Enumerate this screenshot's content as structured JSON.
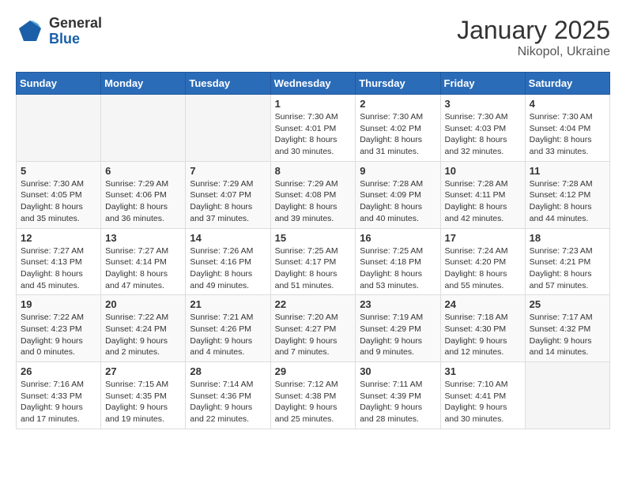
{
  "header": {
    "logo_general": "General",
    "logo_blue": "Blue",
    "title": "January 2025",
    "subtitle": "Nikopol, Ukraine"
  },
  "weekdays": [
    "Sunday",
    "Monday",
    "Tuesday",
    "Wednesday",
    "Thursday",
    "Friday",
    "Saturday"
  ],
  "weeks": [
    [
      {
        "day": "",
        "info": ""
      },
      {
        "day": "",
        "info": ""
      },
      {
        "day": "",
        "info": ""
      },
      {
        "day": "1",
        "info": "Sunrise: 7:30 AM\nSunset: 4:01 PM\nDaylight: 8 hours\nand 30 minutes."
      },
      {
        "day": "2",
        "info": "Sunrise: 7:30 AM\nSunset: 4:02 PM\nDaylight: 8 hours\nand 31 minutes."
      },
      {
        "day": "3",
        "info": "Sunrise: 7:30 AM\nSunset: 4:03 PM\nDaylight: 8 hours\nand 32 minutes."
      },
      {
        "day": "4",
        "info": "Sunrise: 7:30 AM\nSunset: 4:04 PM\nDaylight: 8 hours\nand 33 minutes."
      }
    ],
    [
      {
        "day": "5",
        "info": "Sunrise: 7:30 AM\nSunset: 4:05 PM\nDaylight: 8 hours\nand 35 minutes."
      },
      {
        "day": "6",
        "info": "Sunrise: 7:29 AM\nSunset: 4:06 PM\nDaylight: 8 hours\nand 36 minutes."
      },
      {
        "day": "7",
        "info": "Sunrise: 7:29 AM\nSunset: 4:07 PM\nDaylight: 8 hours\nand 37 minutes."
      },
      {
        "day": "8",
        "info": "Sunrise: 7:29 AM\nSunset: 4:08 PM\nDaylight: 8 hours\nand 39 minutes."
      },
      {
        "day": "9",
        "info": "Sunrise: 7:28 AM\nSunset: 4:09 PM\nDaylight: 8 hours\nand 40 minutes."
      },
      {
        "day": "10",
        "info": "Sunrise: 7:28 AM\nSunset: 4:11 PM\nDaylight: 8 hours\nand 42 minutes."
      },
      {
        "day": "11",
        "info": "Sunrise: 7:28 AM\nSunset: 4:12 PM\nDaylight: 8 hours\nand 44 minutes."
      }
    ],
    [
      {
        "day": "12",
        "info": "Sunrise: 7:27 AM\nSunset: 4:13 PM\nDaylight: 8 hours\nand 45 minutes."
      },
      {
        "day": "13",
        "info": "Sunrise: 7:27 AM\nSunset: 4:14 PM\nDaylight: 8 hours\nand 47 minutes."
      },
      {
        "day": "14",
        "info": "Sunrise: 7:26 AM\nSunset: 4:16 PM\nDaylight: 8 hours\nand 49 minutes."
      },
      {
        "day": "15",
        "info": "Sunrise: 7:25 AM\nSunset: 4:17 PM\nDaylight: 8 hours\nand 51 minutes."
      },
      {
        "day": "16",
        "info": "Sunrise: 7:25 AM\nSunset: 4:18 PM\nDaylight: 8 hours\nand 53 minutes."
      },
      {
        "day": "17",
        "info": "Sunrise: 7:24 AM\nSunset: 4:20 PM\nDaylight: 8 hours\nand 55 minutes."
      },
      {
        "day": "18",
        "info": "Sunrise: 7:23 AM\nSunset: 4:21 PM\nDaylight: 8 hours\nand 57 minutes."
      }
    ],
    [
      {
        "day": "19",
        "info": "Sunrise: 7:22 AM\nSunset: 4:23 PM\nDaylight: 9 hours\nand 0 minutes."
      },
      {
        "day": "20",
        "info": "Sunrise: 7:22 AM\nSunset: 4:24 PM\nDaylight: 9 hours\nand 2 minutes."
      },
      {
        "day": "21",
        "info": "Sunrise: 7:21 AM\nSunset: 4:26 PM\nDaylight: 9 hours\nand 4 minutes."
      },
      {
        "day": "22",
        "info": "Sunrise: 7:20 AM\nSunset: 4:27 PM\nDaylight: 9 hours\nand 7 minutes."
      },
      {
        "day": "23",
        "info": "Sunrise: 7:19 AM\nSunset: 4:29 PM\nDaylight: 9 hours\nand 9 minutes."
      },
      {
        "day": "24",
        "info": "Sunrise: 7:18 AM\nSunset: 4:30 PM\nDaylight: 9 hours\nand 12 minutes."
      },
      {
        "day": "25",
        "info": "Sunrise: 7:17 AM\nSunset: 4:32 PM\nDaylight: 9 hours\nand 14 minutes."
      }
    ],
    [
      {
        "day": "26",
        "info": "Sunrise: 7:16 AM\nSunset: 4:33 PM\nDaylight: 9 hours\nand 17 minutes."
      },
      {
        "day": "27",
        "info": "Sunrise: 7:15 AM\nSunset: 4:35 PM\nDaylight: 9 hours\nand 19 minutes."
      },
      {
        "day": "28",
        "info": "Sunrise: 7:14 AM\nSunset: 4:36 PM\nDaylight: 9 hours\nand 22 minutes."
      },
      {
        "day": "29",
        "info": "Sunrise: 7:12 AM\nSunset: 4:38 PM\nDaylight: 9 hours\nand 25 minutes."
      },
      {
        "day": "30",
        "info": "Sunrise: 7:11 AM\nSunset: 4:39 PM\nDaylight: 9 hours\nand 28 minutes."
      },
      {
        "day": "31",
        "info": "Sunrise: 7:10 AM\nSunset: 4:41 PM\nDaylight: 9 hours\nand 30 minutes."
      },
      {
        "day": "",
        "info": ""
      }
    ]
  ]
}
